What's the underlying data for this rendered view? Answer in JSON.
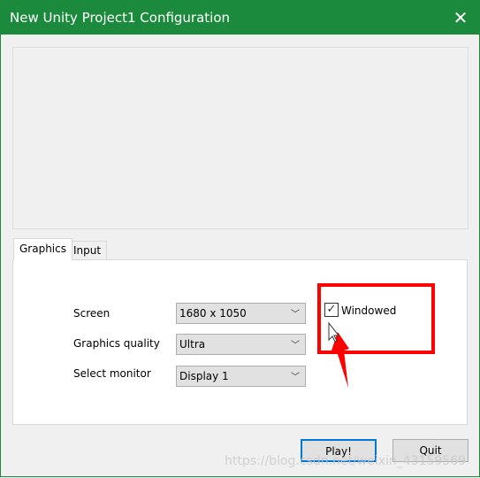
{
  "window": {
    "title": "New Unity Project1 Configuration",
    "close_icon": "close-icon"
  },
  "tabs": [
    {
      "label": "Graphics",
      "active": true
    },
    {
      "label": "Input",
      "active": false
    }
  ],
  "settings": {
    "screen_label": "Screen",
    "screen_value": "1680 x 1050",
    "quality_label": "Graphics quality",
    "quality_value": "Ultra",
    "monitor_label": "Select monitor",
    "monitor_value": "Display 1",
    "windowed_label": "Windowed",
    "windowed_checked": true
  },
  "buttons": {
    "play": "Play!",
    "quit": "Quit"
  },
  "watermark": "https://blog.csdn.net/weixin_43159569",
  "colors": {
    "titlebar": "#1b8a3c",
    "annotation": "#ff0000",
    "focus": "#0078d7"
  }
}
